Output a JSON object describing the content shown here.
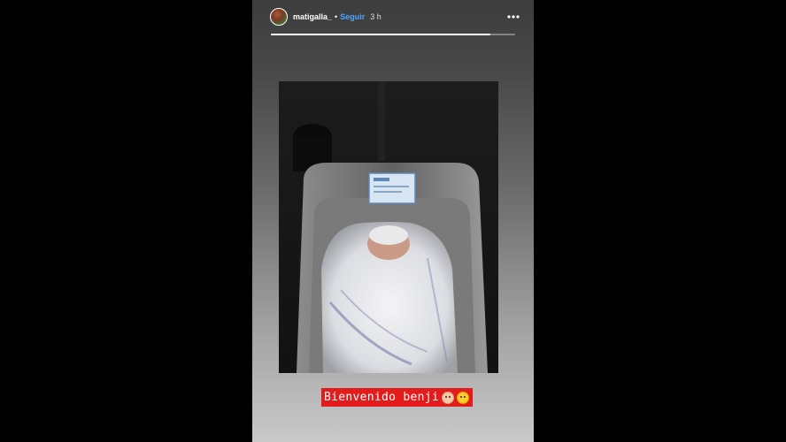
{
  "story": {
    "progress": 0.9,
    "user": {
      "username": "matigalla_",
      "separator": "•",
      "follow_label": "Seguir",
      "timestamp": "3 h"
    },
    "more_icon": "more-horizontal-icon",
    "caption": {
      "text": "Bienvenido benji",
      "background": "#e31b1b",
      "emojis": [
        "baby-emoji",
        "smiling-hearts-emoji"
      ]
    }
  },
  "colors": {
    "page_background": "#000000",
    "follow_link": "#4fa3ff",
    "progress_fill": "#ffffff"
  }
}
